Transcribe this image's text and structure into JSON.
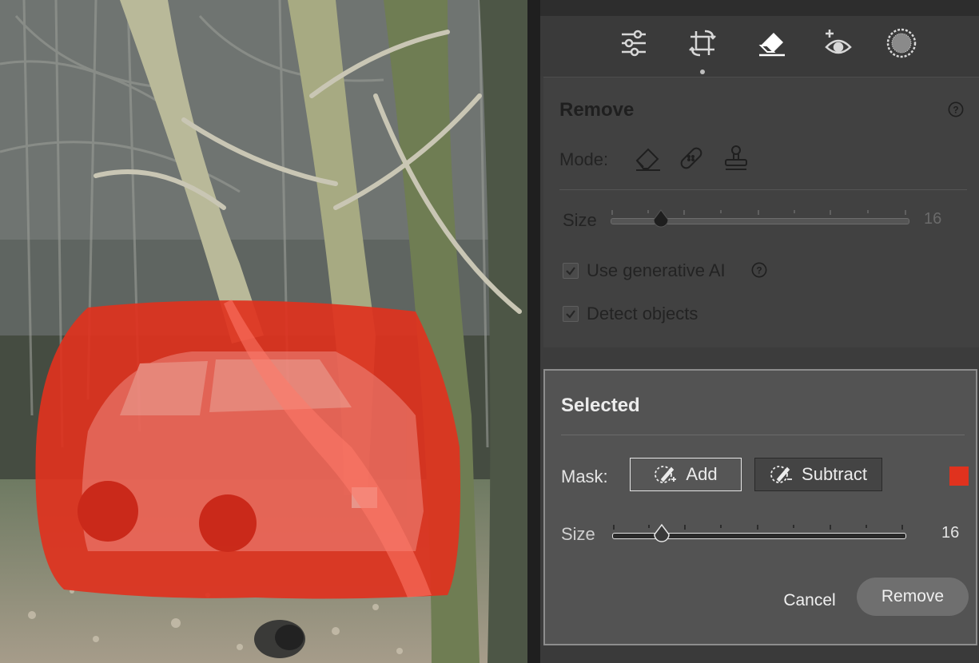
{
  "toolbar": {
    "tools": [
      {
        "icon": "sliders-icon",
        "label": "Edit"
      },
      {
        "icon": "crop-rotate-icon",
        "label": "Crop"
      },
      {
        "icon": "eraser-icon",
        "label": "Remove"
      },
      {
        "icon": "redeye-icon",
        "label": "Red Eye"
      },
      {
        "icon": "masking-icon",
        "label": "Masking"
      }
    ],
    "active": "eraser-icon"
  },
  "remove": {
    "title": "Remove",
    "mode_label": "Mode:",
    "modes": [
      "remove-eraser-icon",
      "heal-bandage-icon",
      "clone-stamp-icon"
    ],
    "size_label": "Size",
    "size_value": "16",
    "size_fraction": 0.17,
    "generative_ai_label": "Use generative AI",
    "generative_ai_checked": true,
    "detect_objects_label": "Detect objects",
    "detect_objects_checked": true
  },
  "selected": {
    "title": "Selected",
    "mask_label": "Mask:",
    "add_label": "Add",
    "subtract_label": "Subtract",
    "overlay_color": "#e0321e",
    "size_label": "Size",
    "size_value": "16",
    "size_fraction": 0.17,
    "cancel_label": "Cancel",
    "remove_label": "Remove"
  },
  "colors": {
    "panel_bg": "#3c3c3c",
    "selected_bg": "#535353",
    "mask_overlay": "#e0321e"
  }
}
